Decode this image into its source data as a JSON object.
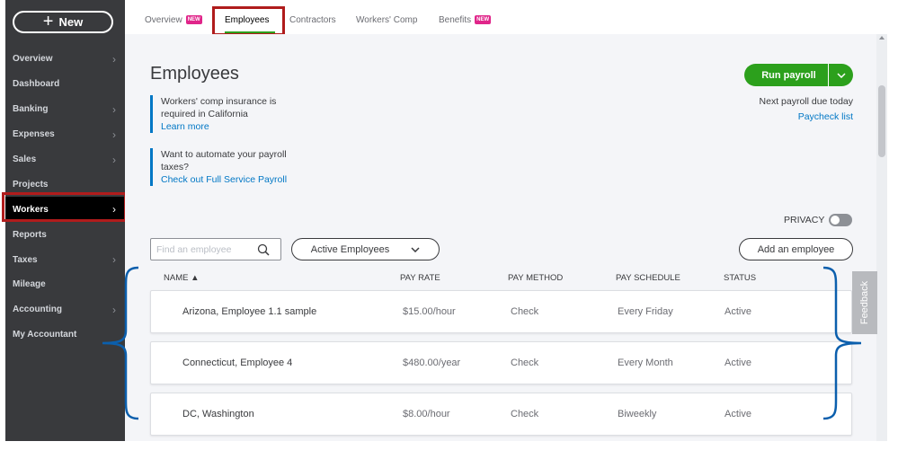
{
  "sidebar": {
    "new_label": "New",
    "items": [
      {
        "label": "Overview",
        "chevron": true
      },
      {
        "label": "Dashboard",
        "chevron": false
      },
      {
        "label": "Banking",
        "chevron": true
      },
      {
        "label": "Expenses",
        "chevron": true
      },
      {
        "label": "Sales",
        "chevron": true
      },
      {
        "label": "Projects",
        "chevron": false
      },
      {
        "label": "Workers",
        "chevron": true,
        "active": true
      },
      {
        "label": "Reports",
        "chevron": false
      },
      {
        "label": "Taxes",
        "chevron": true
      },
      {
        "label": "Mileage",
        "chevron": false
      },
      {
        "label": "Accounting",
        "chevron": true
      },
      {
        "label": "My Accountant",
        "chevron": false
      }
    ]
  },
  "tabs": [
    {
      "label": "Overview",
      "badge": "NEW"
    },
    {
      "label": "Employees",
      "active": true
    },
    {
      "label": "Contractors"
    },
    {
      "label": "Workers' Comp"
    },
    {
      "label": "Benefits",
      "badge": "NEW"
    }
  ],
  "page": {
    "title": "Employees",
    "notice1_text": "Workers' comp insurance is required in California",
    "notice1_link": "Learn more",
    "notice2_text": "Want to automate your payroll taxes?",
    "notice2_link": "Check out Full Service Payroll",
    "run_payroll_label": "Run payroll",
    "next_payroll": "Next payroll due today",
    "paycheck_list": "Paycheck list",
    "privacy_label": "PRIVACY",
    "search_placeholder": "Find an employee",
    "filter_label": "Active Employees",
    "add_employee_label": "Add an employee",
    "feedback_label": "Feedback"
  },
  "table": {
    "headers": {
      "name": "NAME",
      "pay_rate": "PAY RATE",
      "pay_method": "PAY METHOD",
      "pay_schedule": "PAY SCHEDULE",
      "status": "STATUS"
    },
    "rows": [
      {
        "name": "Arizona, Employee 1.1 sample",
        "pay_rate": "$15.00/hour",
        "pay_method": "Check",
        "pay_schedule": "Every Friday",
        "status": "Active"
      },
      {
        "name": "Connecticut, Employee 4",
        "pay_rate": "$480.00/year",
        "pay_method": "Check",
        "pay_schedule": "Every Month",
        "status": "Active"
      },
      {
        "name": "DC, Washington",
        "pay_rate": "$8.00/hour",
        "pay_method": "Check",
        "pay_schedule": "Biweekly",
        "status": "Active"
      }
    ]
  },
  "colors": {
    "sidebar": "#393a3d",
    "accent_green": "#2ca01c",
    "link_blue": "#0077c5",
    "new_badge": "#e0258a",
    "highlight_red": "#b01c1c",
    "annotation_blue": "#0b5fad"
  },
  "icons": {
    "plus": "plus-icon",
    "chevron": "chevron-right-icon",
    "search": "search-icon",
    "dropdown": "chevron-down-icon",
    "sort": "sort-up-icon"
  }
}
